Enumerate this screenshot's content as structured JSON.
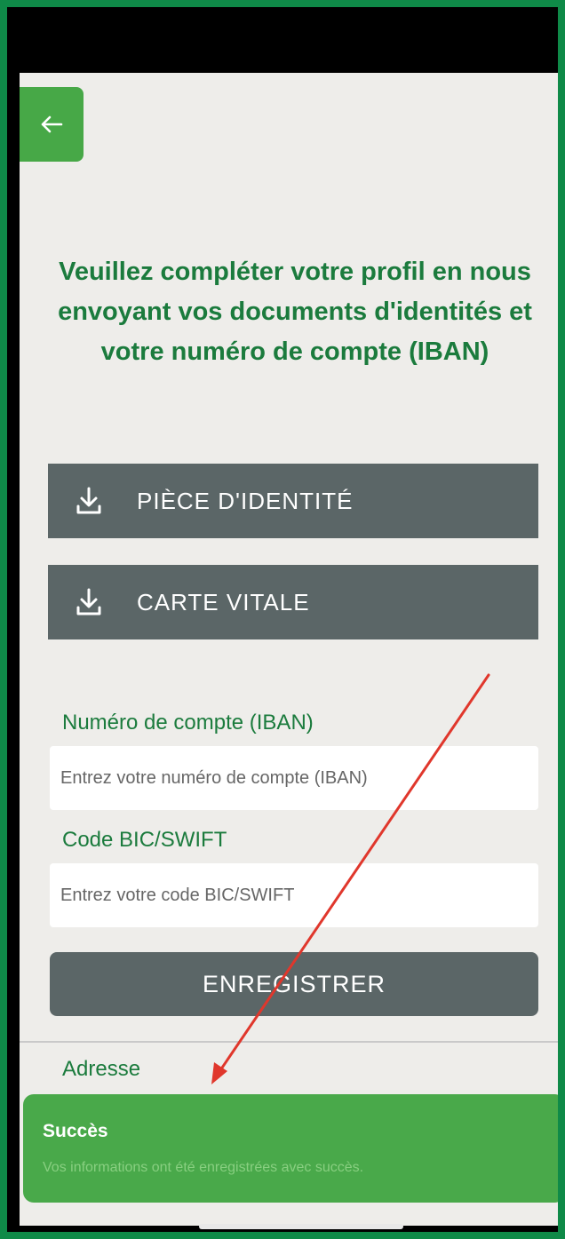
{
  "header": {
    "back_icon": "arrow-left-icon"
  },
  "intro": {
    "text": "Veuillez compléter votre profil en nous envoyant vos documents d'identités et votre numéro de compte (IBAN)"
  },
  "documents": [
    {
      "label": "PIÈCE D'IDENTITÉ",
      "icon": "download-icon"
    },
    {
      "label": "CARTE VITALE",
      "icon": "download-icon"
    }
  ],
  "form": {
    "iban": {
      "label": "Numéro de compte (IBAN)",
      "placeholder": "Entrez votre numéro de compte (IBAN)",
      "value": ""
    },
    "bic": {
      "label": "Code BIC/SWIFT",
      "placeholder": "Entrez votre code BIC/SWIFT",
      "value": ""
    },
    "save_label": "ENREGISTRER"
  },
  "address": {
    "label": "Adresse"
  },
  "toast": {
    "title": "Succès",
    "message": "Vos informations ont été enregistrées avec succès."
  },
  "colors": {
    "accent_green": "#1b7b3d",
    "button_green": "#47a847",
    "button_gray": "#5b6667",
    "background": "#eeedea",
    "annotation_arrow": "#e0372c"
  }
}
